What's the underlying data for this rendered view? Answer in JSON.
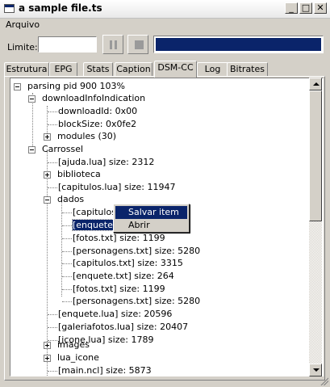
{
  "window": {
    "title": "a sample file.ts",
    "minimize": "_",
    "maximize": "□",
    "close": "✕"
  },
  "menu": {
    "arquivo": "Arquivo"
  },
  "toolbar": {
    "limite_label": "Limite:",
    "limite_value": "",
    "progress": 1.0
  },
  "tabs": [
    "Estrutura",
    "EPG",
    "Stats",
    "Caption",
    "DSM-CC",
    "Log",
    "Bitrates"
  ],
  "active_tab": "DSM-CC",
  "tree": [
    "parsing pid 900 103%",
    "downloadInfoIndication",
    "downloadId: 0x00",
    "blockSize: 0x0fe2",
    "modules (30)",
    "Carrossel",
    "[ajuda.lua] size: 2312",
    "biblioteca",
    "[capitulos.lua] size: 11947",
    "dados",
    "[capitulos.t",
    "[enquete.tx",
    "[fotos.txt] size: 1199",
    "[personagens.txt] size: 5280",
    "[capitulos.txt] size: 3315",
    "[enquete.txt] size: 264",
    "[fotos.txt] size: 1199",
    "[personagens.txt] size: 5280",
    "[enquete.lua] size: 20596",
    "[galeriafotos.lua] size: 20407",
    "[icone.lua] size: 1789",
    "images",
    "lua_icone",
    "[main.ncl] size: 5873"
  ],
  "context_menu": [
    "Salvar item",
    "Abrir"
  ],
  "colors": {
    "selection": "#0a246a",
    "face": "#d4d0c8"
  }
}
